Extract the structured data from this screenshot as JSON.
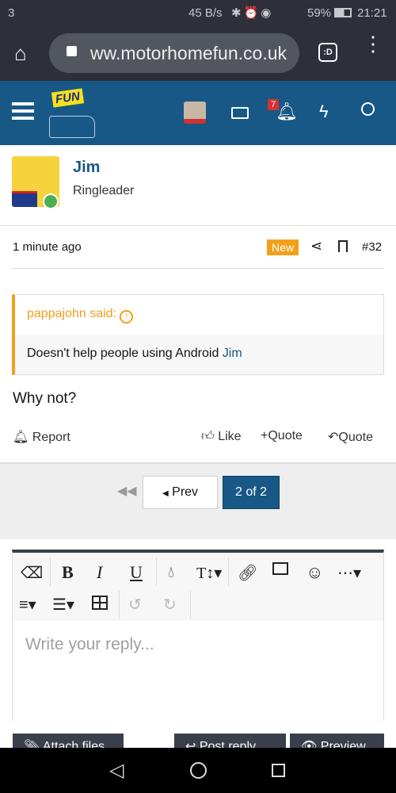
{
  "status_bar": {
    "notification_count": "3",
    "net_speed": "45 B/s",
    "battery": "59%",
    "time": "21:21"
  },
  "browser": {
    "url": "ww.motorhomefun.co.uk",
    "tab_switcher": ":D"
  },
  "site_header": {
    "logo_text": "FUN",
    "notification_badge": "7",
    "colors": {
      "header": "#185886"
    }
  },
  "post": {
    "author": "Jim",
    "role": "Ringleader",
    "time": "1 minute ago",
    "new_badge": "New",
    "post_number": "#32",
    "quote": {
      "author_said": "pappajohn said:",
      "text": "Doesn't help people using Android ",
      "mention": "Jim"
    },
    "body": "Why not?",
    "actions": {
      "report": "Report",
      "like": "Like",
      "multi_quote": "Quote",
      "quote": "Quote"
    }
  },
  "pagination": {
    "prev": "Prev",
    "current": "2 of 2"
  },
  "editor": {
    "placeholder": "Write your reply...",
    "attach": "Attach files",
    "post_reply": "Post reply",
    "preview": "Preview"
  }
}
